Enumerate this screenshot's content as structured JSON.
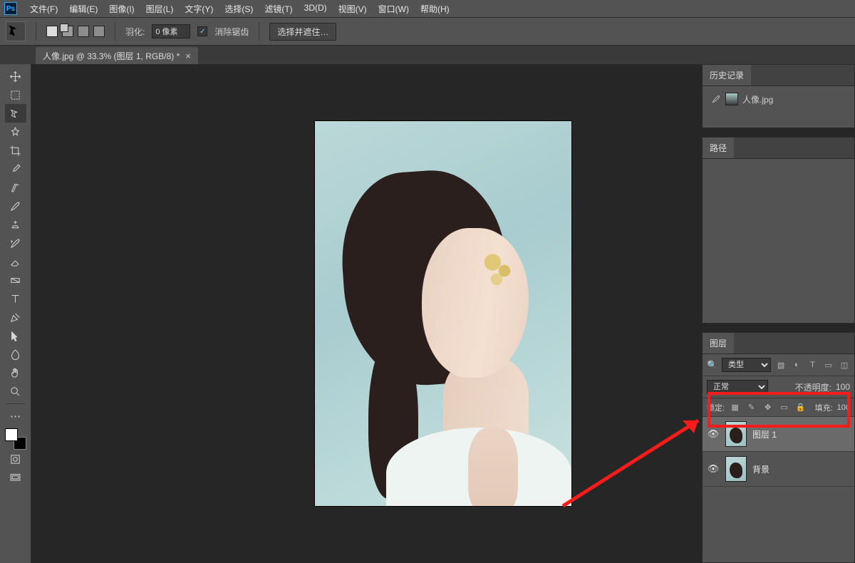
{
  "menubar": {
    "items": [
      "文件(F)",
      "编辑(E)",
      "图像(I)",
      "图层(L)",
      "文字(Y)",
      "选择(S)",
      "滤镜(T)",
      "3D(D)",
      "视图(V)",
      "窗口(W)",
      "帮助(H)"
    ]
  },
  "optionsbar": {
    "feather_label": "羽化:",
    "feather_value": "0 像素",
    "antialias_label": "消除锯齿",
    "select_mask_btn": "选择并遮住…"
  },
  "doctab": {
    "title": "人像.jpg @ 33.3% (图层 1, RGB/8) *"
  },
  "tools": [
    "move",
    "artboard",
    "marquee",
    "lasso",
    "wand",
    "crop",
    "eyedropper",
    "heal",
    "brush",
    "stamp",
    "history-brush",
    "eraser",
    "gradient",
    "blur",
    "dodge",
    "pen",
    "type",
    "path",
    "shape",
    "hand",
    "zoom"
  ],
  "panels": {
    "history_tab": "历史记录",
    "history_item": "人像.jpg",
    "paths_tab": "路径",
    "layers_tab": "图层",
    "layer_filter": "类型",
    "blend_mode": "正常",
    "opacity_label": "不透明度:",
    "opacity_value": "100",
    "lock_label": "锁定:",
    "fill_label": "填充:",
    "fill_value": "100",
    "layers": [
      {
        "name": "图层 1",
        "selected": true
      },
      {
        "name": "背景",
        "selected": false
      }
    ]
  }
}
